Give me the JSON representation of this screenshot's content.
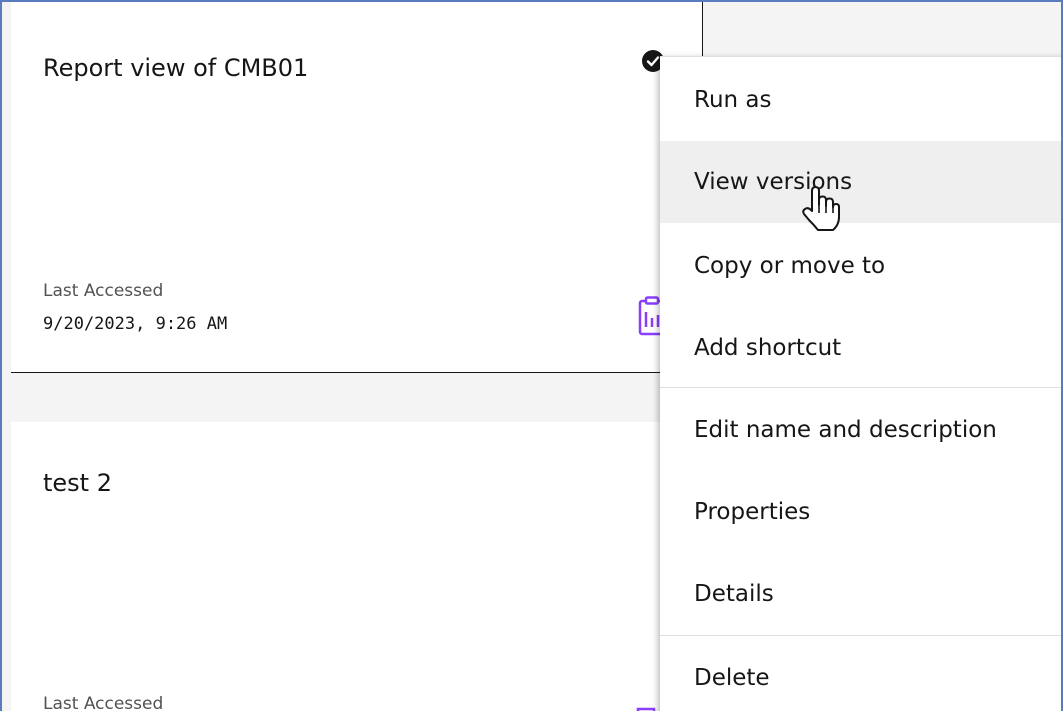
{
  "cards": [
    {
      "title": "Report view of CMB01",
      "last_accessed_label": "Last Accessed",
      "last_accessed_value": "9/20/2023, 9:26 AM",
      "selected": true
    },
    {
      "title": "test 2",
      "last_accessed_label": "Last Accessed"
    }
  ],
  "context_menu": {
    "items": [
      {
        "label": "Run as"
      },
      {
        "label": "View versions",
        "hovered": true
      },
      {
        "label": "Copy or move to"
      },
      {
        "label": "Add shortcut"
      },
      {
        "label": "Edit name and description"
      },
      {
        "label": "Properties"
      },
      {
        "label": "Details"
      },
      {
        "label": "Delete"
      }
    ]
  },
  "colors": {
    "accent_purple": "#8a3ffc",
    "frame_blue": "#5b7bbf",
    "text_primary": "#161616",
    "text_secondary": "#525252",
    "menu_hover": "#efefef"
  },
  "icons": {
    "selected": "checkmark-filled-icon",
    "item_type": "report-clipboard-icon",
    "cursor": "hand-pointer-icon"
  }
}
